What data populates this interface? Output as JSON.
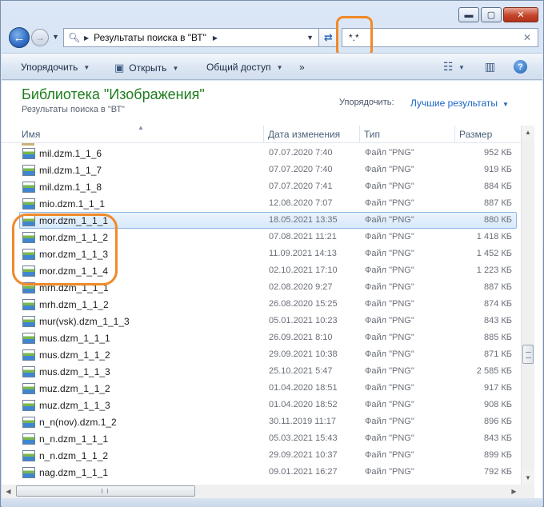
{
  "titlebar": {
    "minimize": "▬",
    "maximize": "▢",
    "close": "✕"
  },
  "address": {
    "crumb": "Результаты поиска в \"ВТ\""
  },
  "search": {
    "query": "*.*",
    "clear": "✕"
  },
  "commandbar": {
    "organize": "Упорядочить",
    "open": "Открыть",
    "share": "Общий доступ",
    "more": "»"
  },
  "library": {
    "title": "Библиотека \"Изображения\"",
    "subtitle": "Результаты поиска в \"ВТ\"",
    "sort_label": "Упорядочить:",
    "sort_value": "Лучшие результаты"
  },
  "columns": {
    "name": "Имя",
    "date": "Дата изменения",
    "type": "Тип",
    "size": "Размер"
  },
  "files": [
    {
      "name": "mil.dzm.1_1_6",
      "date": "07.07.2020 7:40",
      "type": "Файл \"PNG\"",
      "size": "952 КБ"
    },
    {
      "name": "mil.dzm.1_1_7",
      "date": "07.07.2020 7:40",
      "type": "Файл \"PNG\"",
      "size": "919 КБ"
    },
    {
      "name": "mil.dzm.1_1_8",
      "date": "07.07.2020 7:41",
      "type": "Файл \"PNG\"",
      "size": "884 КБ"
    },
    {
      "name": "mio.dzm.1_1_1",
      "date": "12.08.2020 7:07",
      "type": "Файл \"PNG\"",
      "size": "887 КБ"
    },
    {
      "name": "mor.dzm_1_1_1",
      "date": "18.05.2021 13:35",
      "type": "Файл \"PNG\"",
      "size": "880 КБ"
    },
    {
      "name": "mor.dzm_1_1_2",
      "date": "07.08.2021 11:21",
      "type": "Файл \"PNG\"",
      "size": "1 418 КБ"
    },
    {
      "name": "mor.dzm_1_1_3",
      "date": "11.09.2021 14:13",
      "type": "Файл \"PNG\"",
      "size": "1 452 КБ"
    },
    {
      "name": "mor.dzm_1_1_4",
      "date": "02.10.2021 17:10",
      "type": "Файл \"PNG\"",
      "size": "1 223 КБ"
    },
    {
      "name": "mrh.dzm_1_1_1",
      "date": "02.08.2020 9:27",
      "type": "Файл \"PNG\"",
      "size": "887 КБ"
    },
    {
      "name": "mrh.dzm_1_1_2",
      "date": "26.08.2020 15:25",
      "type": "Файл \"PNG\"",
      "size": "874 КБ"
    },
    {
      "name": "mur(vsk).dzm_1_1_3",
      "date": "05.01.2021 10:23",
      "type": "Файл \"PNG\"",
      "size": "843 КБ"
    },
    {
      "name": "mus.dzm_1_1_1",
      "date": "26.09.2021 8:10",
      "type": "Файл \"PNG\"",
      "size": "885 КБ"
    },
    {
      "name": "mus.dzm_1_1_2",
      "date": "29.09.2021 10:38",
      "type": "Файл \"PNG\"",
      "size": "871 КБ"
    },
    {
      "name": "mus.dzm_1_1_3",
      "date": "25.10.2021 5:47",
      "type": "Файл \"PNG\"",
      "size": "2 585 КБ"
    },
    {
      "name": "muz.dzm_1_1_2",
      "date": "01.04.2020 18:51",
      "type": "Файл \"PNG\"",
      "size": "917 КБ"
    },
    {
      "name": "muz.dzm_1_1_3",
      "date": "01.04.2020 18:52",
      "type": "Файл \"PNG\"",
      "size": "908 КБ"
    },
    {
      "name": "n_n(nov).dzm.1_2",
      "date": "30.11.2019 11:17",
      "type": "Файл \"PNG\"",
      "size": "896 КБ"
    },
    {
      "name": "n_n.dzm_1_1_1",
      "date": "05.03.2021 15:43",
      "type": "Файл \"PNG\"",
      "size": "843 КБ"
    },
    {
      "name": "n_n.dzm_1_1_2",
      "date": "29.09.2021 10:37",
      "type": "Файл \"PNG\"",
      "size": "899 КБ"
    },
    {
      "name": "nag.dzm_1_1_1",
      "date": "09.01.2021 16:27",
      "type": "Файл \"PNG\"",
      "size": "792 КБ"
    }
  ],
  "selected_file": "mor.dzm_1_1_1",
  "colors": {
    "library_title": "#1e7d1e",
    "link": "#1a64c4",
    "callout": "#f08a2a"
  }
}
